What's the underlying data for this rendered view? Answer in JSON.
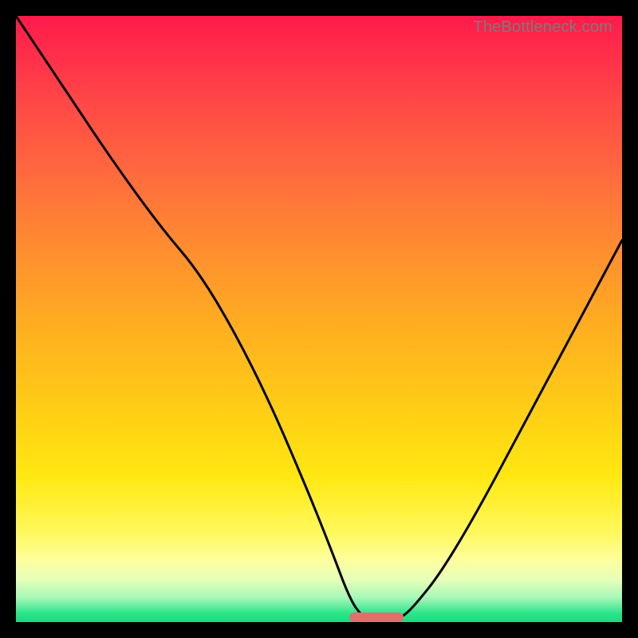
{
  "attribution": "TheBottleneck.com",
  "colors": {
    "frame": "#000000",
    "curve": "#000000",
    "marker": "#e36f6a",
    "gradient_top": "#ff1a4b",
    "gradient_bottom": "#18db7e"
  },
  "chart_data": {
    "type": "line",
    "title": "",
    "xlabel": "",
    "ylabel": "",
    "xlim": [
      0,
      100
    ],
    "ylim": [
      0,
      100
    ],
    "grid": false,
    "series": [
      {
        "name": "bottleneck-curve",
        "x": [
          0,
          8,
          16,
          24,
          30,
          36,
          42,
          48,
          52,
          55,
          57,
          59,
          60,
          62,
          64,
          66,
          70,
          76,
          84,
          92,
          100
        ],
        "values": [
          100,
          88,
          76,
          65,
          58,
          48,
          36,
          22,
          12,
          4,
          1,
          0,
          0,
          0,
          1,
          3,
          8,
          18,
          33,
          48,
          63
        ]
      }
    ],
    "marker": {
      "x_start": 55,
      "x_end": 64,
      "y": 0
    },
    "annotations": []
  }
}
